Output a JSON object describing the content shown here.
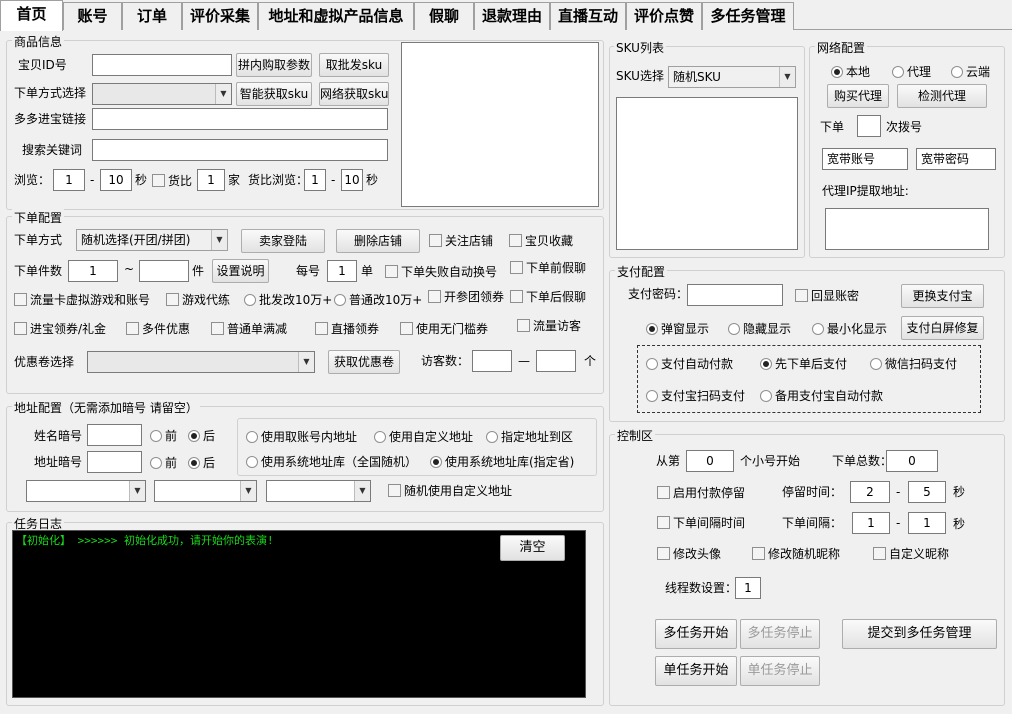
{
  "tabs": [
    "首页",
    "账号",
    "订单",
    "评价采集",
    "地址和虚拟产品信息",
    "假聊",
    "退款理由",
    "直播互动",
    "评价点赞",
    "多任务管理"
  ],
  "product": {
    "title": "商品信息",
    "id_label": "宝贝ID号",
    "btn_pdd": "拼内购取参数",
    "btn_take": "取批发sku",
    "order_mode_label": "下单方式选择",
    "btn_smart": "智能获取sku",
    "btn_net": "网络获取sku",
    "shop_link_label": "多多进宝链接",
    "keyword_label": "搜索关键词",
    "browse_label": "浏览：",
    "browse_min": "1",
    "browse_max": "10",
    "sec": "秒",
    "dash": "-",
    "compare_label": "货比",
    "compare_count": "1",
    "home": "家",
    "compare_browse_label": "货比浏览：",
    "cb_min": "1",
    "cb_max": "10"
  },
  "sku": {
    "title": "SKU列表",
    "select_label": "SKU选择",
    "select_value": "随机SKU"
  },
  "network": {
    "title": "网络配置",
    "radio_local": "本地",
    "radio_proxy": "代理",
    "radio_cloud": "云端",
    "btn_buy": "购买代理",
    "btn_check": "检测代理",
    "order_label": "下单",
    "dial_label": "次拨号",
    "broadband_account": "宽带账号",
    "broadband_pwd": "宽带密码",
    "proxy_ip_label": "代理IP提取地址:"
  },
  "order": {
    "title": "下单配置",
    "mode_label": "下单方式",
    "mode_value": "随机选择(开团/拼团)",
    "btn_buyer": "卖家登陆",
    "btn_delete": "删除店铺",
    "follow_shop": "关注店铺",
    "fav": "宝贝收藏",
    "count_label": "下单件数",
    "count_min": "1",
    "tilde": "~",
    "piece": "件",
    "btn_setting": "设置说明",
    "per_label": "每号",
    "per_value": "1",
    "per_unit": "单",
    "fail_switch": "下单失败自动换号",
    "before_fake": "下单前假聊",
    "traffic_game": "流量卡虚拟游戏和账号",
    "game_boost": "游戏代练",
    "wholesale_10w": "批发改10万+",
    "normal_10w": "普通改10万+",
    "group_coupon": "开参团领券",
    "after_fake": "下单后假聊",
    "jinbao_coupon": "进宝领券/礼金",
    "multi_discount": "多件优惠",
    "normal_full": "普通单满减",
    "live_coupon": "直播领券",
    "no_threshold": "使用无门槛券",
    "traffic_visit": "流量访客",
    "coupon_label": "优惠卷选择",
    "btn_coupon": "获取优惠卷",
    "visitor_label": "访客数：",
    "dash": "—",
    "ge": "个"
  },
  "pay": {
    "title": "支付配置",
    "pwd_label": "支付密码：",
    "show_pwd": "回显账密",
    "btn_change": "更换支付宝",
    "popup": "弹窗显示",
    "hidden": "隐藏显示",
    "minimize": "最小化显示",
    "btn_fix": "支付白屏修复",
    "auto_pay": "支付自动付款",
    "order_then_pay": "先下单后支付",
    "wechat_qr": "微信扫码支付",
    "alipay_qr": "支付宝扫码支付",
    "backup_alipay": "备用支付宝自动付款"
  },
  "address": {
    "title": "地址配置（无需添加暗号 请留空）",
    "name_code": "姓名暗号",
    "addr_code": "地址暗号",
    "before": "前",
    "after": "后",
    "use_account_addr": "使用取账号内地址",
    "use_custom_addr": "使用自定义地址",
    "specify_district": "指定地址到区",
    "use_sys_national": "使用系统地址库（全国随机）",
    "use_sys_province": "使用系统地址库(指定省)",
    "random_custom": "随机使用自定义地址"
  },
  "log": {
    "title": "任务日志",
    "line": "【初始化】 >>>>>>  初始化成功，请开始你的表演!",
    "btn_clear": "清空"
  },
  "control": {
    "title": "控制区",
    "from_label": "从第",
    "from_value": "0",
    "start_label": "个小号开始",
    "total_label": "下单总数：",
    "total_value": "0",
    "pay_stay": "启用付款停留",
    "stay_time_label": "停留时间：",
    "stay_min": "2",
    "stay_max": "5",
    "sec": "秒",
    "dash": "-",
    "order_interval": "下单间隔时间",
    "interval_label": "下单间隔：",
    "int_min": "1",
    "int_max": "1",
    "avatar": "修改头像",
    "random_nick": "修改随机昵称",
    "custom_nick": "自定义昵称",
    "thread_label": "线程数设置：",
    "thread_value": "1",
    "btn_multi_start": "多任务开始",
    "btn_multi_stop": "多任务停止",
    "btn_submit": "提交到多任务管理",
    "btn_single_start": "单任务开始",
    "btn_single_stop": "单任务停止"
  }
}
